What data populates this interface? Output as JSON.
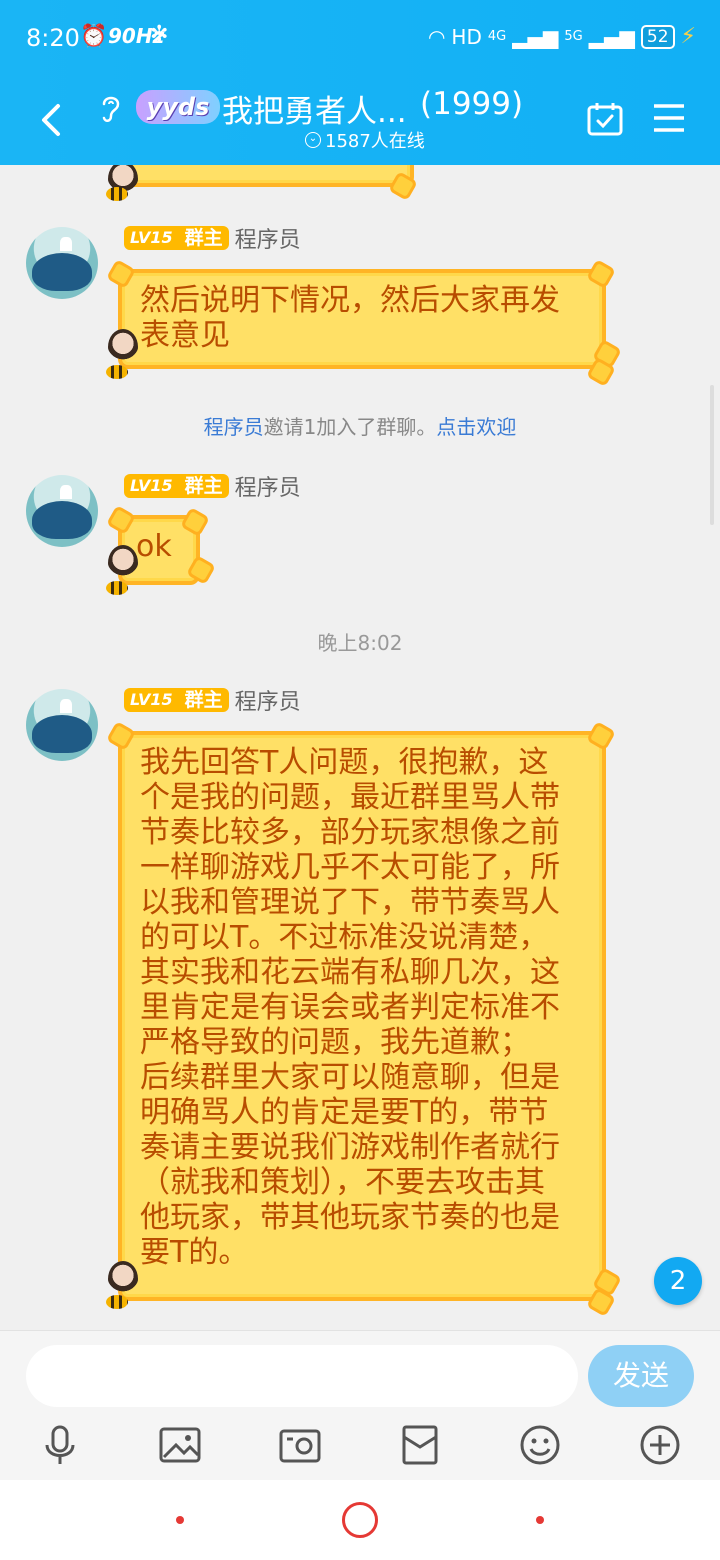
{
  "status_bar": {
    "time": "8:20",
    "refresh_rate": "90Hz",
    "network": "HD",
    "signal_4g": "4G",
    "signal_5g": "5G",
    "battery": "52"
  },
  "header": {
    "logo_text": "yyds",
    "title": "我把勇者人...",
    "member_count": "(1999)",
    "online": "1587人在线"
  },
  "messages": [
    {
      "sender_level": "LV15",
      "sender_role": "群主",
      "sender_name": "程序员",
      "text_lines": [
        "然后说明下情况，然后大家再发",
        "表意见"
      ]
    },
    {
      "sender_level": "LV15",
      "sender_role": "群主",
      "sender_name": "程序员",
      "text_lines": [
        "ok"
      ]
    },
    {
      "sender_level": "LV15",
      "sender_role": "群主",
      "sender_name": "程序员",
      "text_lines": [
        "我先回答T人问题，很抱歉，这",
        "个是我的问题，最近群里骂人带",
        "节奏比较多，部分玩家想像之前",
        "一样聊游戏几乎不太可能了，所",
        "以我和管理说了下，带节奏骂人",
        "的可以T。不过标准没说清楚，",
        "其实我和花云端有私聊几次，这",
        "里肯定是有误会或者判定标准不",
        "严格导致的问题，我先道歉；",
        "后续群里大家可以随意聊，但是",
        "明确骂人的肯定是要T的，带节",
        "奏请主要说我们游戏制作者就行",
        "（就我和策划），不要去攻击其",
        "他玩家，带其他玩家节奏的也是",
        "要T的。"
      ]
    }
  ],
  "system_message": {
    "actor": "程序员",
    "action": "邀请1加入了群聊。",
    "link": "点击欢迎"
  },
  "time_separator": "晚上8:02",
  "unread_count": "2",
  "input": {
    "placeholder": "",
    "send_label": "发送"
  },
  "toolbar_icons": [
    "microphone-icon",
    "image-icon",
    "camera-icon",
    "red-packet-icon",
    "emoji-icon",
    "plus-icon"
  ],
  "colors": {
    "header_bg": "#12b0f5",
    "bubble_bg": "#ffe066",
    "bubble_border": "#ffb425",
    "bubble_text": "#b84d00",
    "send_button": "#8fd0f5",
    "link": "#3a7bd5"
  }
}
